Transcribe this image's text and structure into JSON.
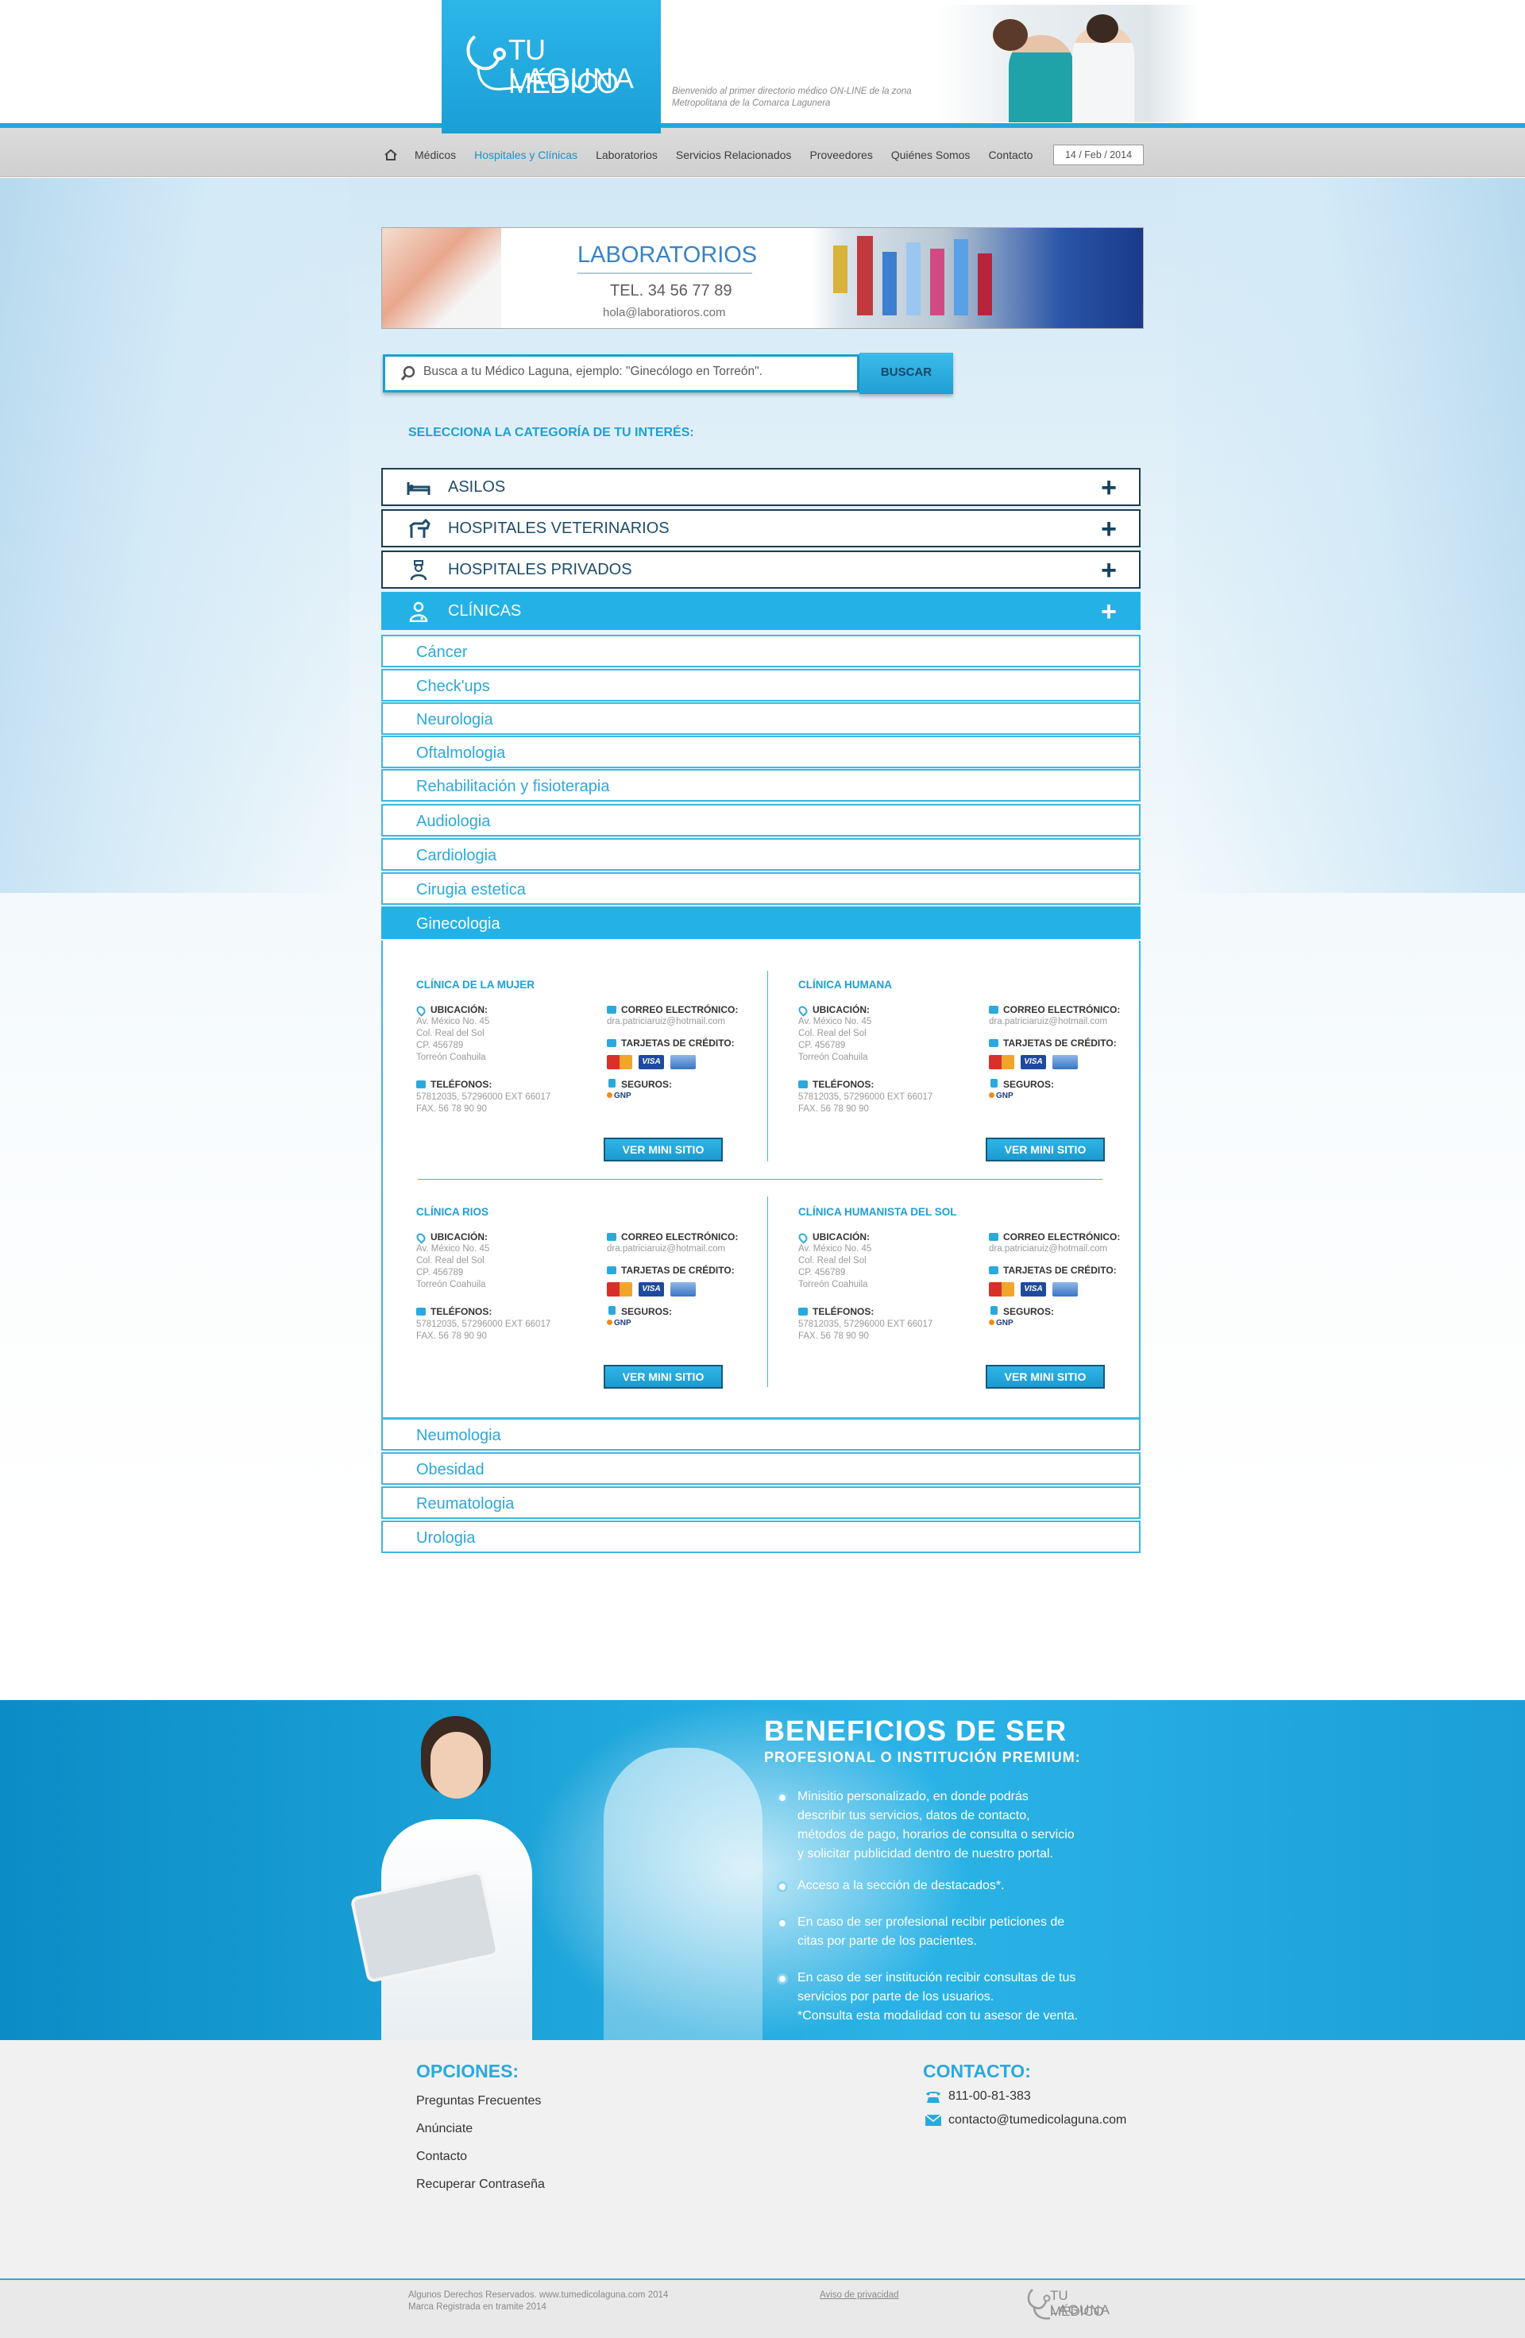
{
  "header": {
    "logo_line1": "TU MÉDICO",
    "logo_line2": "LAGUNA",
    "tagline": "Bienvenido al primer directorio médico ON-LINE de la zona Metropolitana de la Comarca Lagunera"
  },
  "nav": {
    "home_icon": "home-icon",
    "items": [
      "Médicos",
      "Hospitales y Clínicas",
      "Laboratorios",
      "Servicios Relacionados",
      "Proveedores",
      "Quiénes Somos",
      "Contacto"
    ],
    "active": "Hospitales y Clínicas",
    "date": "14 / Feb / 2014"
  },
  "banner": {
    "title": "LABORATORIOS",
    "tel": "TEL. 34 56 77 89",
    "email": "hola@laboratioros.com"
  },
  "search": {
    "placeholder": "Busca a tu Médico Laguna, ejemplo: \"Ginecólogo en Torreón\".",
    "button": "BUSCAR"
  },
  "select_category": "SELECCIONA LA CATEGORÍA DE TU INTERÉS:",
  "categories": [
    {
      "label": "ASILOS",
      "icon": "bed-icon"
    },
    {
      "label": "HOSPITALES VETERINARIOS",
      "icon": "dog-icon"
    },
    {
      "label": "HOSPITALES PRIVADOS",
      "icon": "nurse-icon"
    },
    {
      "label": "CLÍNICAS",
      "icon": "doctor-icon"
    }
  ],
  "subcategories_top": [
    "Cáncer",
    "Check'ups",
    "Neurologia",
    "Oftalmologia",
    "Rehabilitación y fisioterapia",
    "Audiologia",
    "Cardiologia",
    "Cirugia estetica",
    "Ginecologia"
  ],
  "subcategories_bottom": [
    "Neumologia",
    "Obesidad",
    "Reumatologia",
    "Urologia"
  ],
  "labels": {
    "ubicacion": "UBICACIÓN:",
    "correo": "CORREO ELECTRÓNICO:",
    "tarjetas": "TARJETAS DE CRÉDITO:",
    "seguros": "SEGUROS:",
    "telefonos": "TELÉFONOS:",
    "button": "VER MINI SITIO",
    "gnp": "GNP",
    "visa": "VISA"
  },
  "clinics": [
    {
      "name": "CLÍNICA DE LA MUJER",
      "address": [
        "Av. México No. 45",
        "Col. Real del Sol",
        "CP. 456789",
        "Torreón Coahuila"
      ],
      "email": "dra.patriciaruiz@hotmail.com",
      "phones": [
        "57812035, 57296000 EXT 66017",
        "FAX. 56 78 90 90"
      ]
    },
    {
      "name": "CLÍNICA HUMANA",
      "address": [
        "Av. México No. 45",
        "Col. Real del Sol",
        "CP. 456789",
        "Torreón Coahuila"
      ],
      "email": "dra.patriciaruiz@hotmail.com",
      "phones": [
        "57812035, 57296000 EXT 66017",
        "FAX. 56 78 90 90"
      ]
    },
    {
      "name": "CLÍNICA RIOS",
      "address": [
        "Av. México No. 45",
        "Col. Real del Sol",
        "CP. 456789",
        "Torreón Coahuila"
      ],
      "email": "dra.patriciaruiz@hotmail.com",
      "phones": [
        "57812035, 57296000 EXT 66017",
        "FAX. 56 78 90 90"
      ]
    },
    {
      "name": "CLÍNICA HUMANISTA DEL SOL",
      "address": [
        "Av. México No. 45",
        "Col. Real del Sol",
        "CP. 456789",
        "Torreón Coahuila"
      ],
      "email": "dra.patriciaruiz@hotmail.com",
      "phones": [
        "57812035, 57296000 EXT 66017",
        "FAX. 56 78 90 90"
      ]
    }
  ],
  "benefits": {
    "title": "BENEFICIOS DE SER",
    "subtitle": "PROFESIONAL O INSTITUCIÓN PREMIUM:",
    "items": [
      [
        "Minisitio personalizado, en donde podrás",
        "describir tus servicios,  datos de contacto,",
        "métodos de pago, horarios de consulta o servicio",
        "y solicitar publicidad dentro de nuestro portal."
      ],
      [
        "Acceso a la sección de destacados*."
      ],
      [
        "En caso de ser profesional recibir peticiones de",
        "citas por parte de los pacientes."
      ],
      [
        "En caso de ser institución recibir consultas de tus",
        "servicios por parte de los usuarios.",
        "*Consulta esta modalidad con tu asesor de venta."
      ]
    ]
  },
  "footer": {
    "options_title": "OPCIONES:",
    "options": [
      "Preguntas Frecuentes",
      "Anúnciate",
      "Contacto",
      "Recuperar Contraseña"
    ],
    "contact_title": "CONTACTO:",
    "phone": "811-00-81-383",
    "email": "contacto@tumedicolaguna.com",
    "rights_line1": "Algunos Derechos Reservados. www.tumedicolaguna.com 2014",
    "rights_line2": "Marca Registrada en tramite 2014",
    "privacy": "Aviso de privacidad",
    "logo_line1": "TU MÉDICO",
    "logo_line2": "LAGUNA"
  },
  "colors": {
    "brand": "#24b2e6",
    "navy": "#1d3d52",
    "nav_active": "#1a92c6"
  }
}
